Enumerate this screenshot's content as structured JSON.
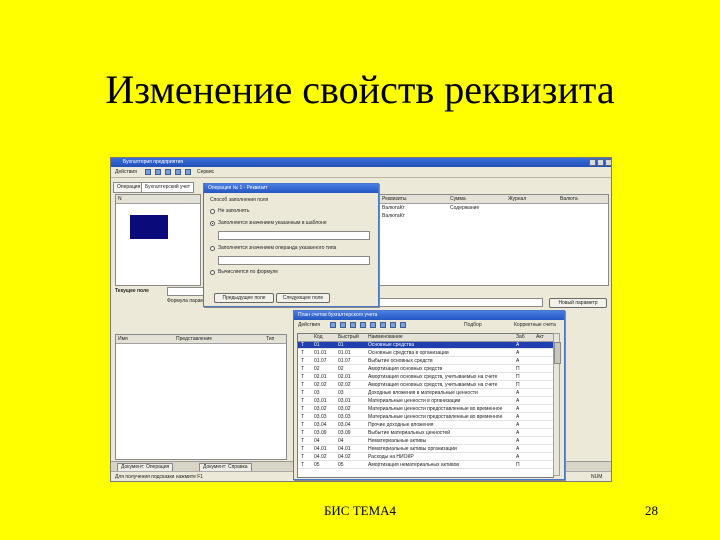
{
  "slide": {
    "title": "Изменение свойств реквизита",
    "footer": "БИС ТЕМА4",
    "page_number": "28"
  },
  "app": {
    "window_title": "Бухгалтерия предприятия",
    "menu_actions": "Действия",
    "menu_goto": "Сервис",
    "tabs": [
      "Операция",
      "Бухгалтерский учет"
    ],
    "left_label": "Текущее поле",
    "bottom_label": "Формула параметра",
    "right_button": "Новый параметр",
    "panel_headers": [
      "Имя",
      "Представление",
      "Тип"
    ],
    "right_headers": [
      "Реквизиты",
      "Сумма",
      "Журнал",
      "Валюта"
    ],
    "right_rows": [
      [
        "ВалютаКт",
        "Содержание"
      ],
      [
        "ВалютаКт"
      ]
    ],
    "status_text": "Для получения подсказки нажмите F1",
    "status_right": "NUM",
    "task_1": "Документ: Операция",
    "task_2": "Документ: Справка"
  },
  "dialog_props": {
    "title": "Операция № 1 - Реквизит",
    "option_group": "Способ заполнения поля",
    "options": [
      "Не заполнять",
      "Заполняется значением указанным в шаблоне",
      "Заполняется значением операнда указанного типа",
      "Вычисляется по формуле"
    ],
    "selected_option_index": 1,
    "button_prev": "Предыдущее поле",
    "button_next": "Следующее поле"
  },
  "dialog_list": {
    "title": "План счетов бухгалтерского учета",
    "toolbar_actions": "Действия",
    "toolbar_mode": "Подбор",
    "toolbar_quick": "Корректные счета",
    "columns": [
      "Код",
      "Быстрый",
      "Наименование",
      "Заб",
      "Акт"
    ],
    "rows": [
      [
        "01",
        "01",
        "Основные средства",
        "А",
        ""
      ],
      [
        "01.01",
        "01.01",
        "Основные средства в организации",
        "А",
        ""
      ],
      [
        "01.07",
        "01.07",
        "Выбытие основных средств",
        "А",
        ""
      ],
      [
        "02",
        "02",
        "Амортизация основных средств",
        "П",
        ""
      ],
      [
        "02.01",
        "02.01",
        "Амортизация основных средств, учитываемых на счете",
        "П",
        ""
      ],
      [
        "02.02",
        "02.02",
        "Амортизация основных средств, учитываемых на счете",
        "П",
        ""
      ],
      [
        "03",
        "03",
        "Доходные вложения в материальные ценности",
        "А",
        ""
      ],
      [
        "03.01",
        "03.01",
        "Материальные ценности в организации",
        "А",
        ""
      ],
      [
        "03.02",
        "03.02",
        "Материальные ценности предоставленные во временное",
        "А",
        ""
      ],
      [
        "03.03",
        "03.03",
        "Материальные ценности предоставленные во временное",
        "А",
        ""
      ],
      [
        "03.04",
        "03.04",
        "Прочие доходные вложения",
        "А",
        ""
      ],
      [
        "03.09",
        "03.09",
        "Выбытие материальных ценностей",
        "А",
        ""
      ],
      [
        "04",
        "04",
        "Нематериальные активы",
        "А",
        ""
      ],
      [
        "04.01",
        "04.01",
        "Нематериальные активы организации",
        "А",
        ""
      ],
      [
        "04.02",
        "04.02",
        "Расходы на НИОКР",
        "А",
        ""
      ],
      [
        "05",
        "05",
        "Амортизация нематериальных активов",
        "П",
        ""
      ]
    ],
    "selected_row_index": 0
  },
  "colors": {
    "slide_bg": "#ffff00",
    "title_bar": "#2456c2",
    "selection": "#1f3fb0"
  }
}
